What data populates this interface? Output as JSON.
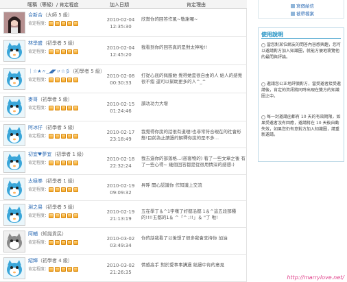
{
  "header": {
    "user_col": "暱稱（等級）/ 肯定程度",
    "date_col": "加入日期",
    "reason_col": "肯定理由"
  },
  "fame_label": "肯定程度：",
  "rows": [
    {
      "name": "合新合",
      "level": "（大師 5 級）",
      "date": "2010-02-04",
      "time": "12:35:30",
      "reason": "欣賞你的回答作風~敬謝囉~",
      "avatar": "photo",
      "coins": 5
    },
    {
      "name": "林學盛",
      "level": "（初學者 5 級）",
      "date": "2010-02-04",
      "time": "12:45:20",
      "reason": "我看到你的回答真的是對太神啦!!",
      "avatar": "cat",
      "coins": 5
    },
    {
      "name": "｜☆★〃_◢◤〃☆彡",
      "level": "（初學者 5 級）",
      "date": "2010-02-08",
      "time": "00:30:33",
      "reason": "打從心底的佩服她 覺得她是很自由的人 給人的感覺很不錯 還可以幫助更多的人^_^",
      "avatar": "cat",
      "coins": 5
    },
    {
      "name": "麥哥",
      "level": "（初學者 5 級）",
      "date": "2010-02-15",
      "time": "01:24:46",
      "reason": "讀功功力大增",
      "avatar": "cat",
      "coins": 5
    },
    {
      "name": "阿冰仔",
      "level": "（初學者 5 級）",
      "date": "2010-02-17",
      "time": "23:18:49",
      "reason": "我覺得你說的話很有道理!也非常符合現在的社會形態!目前為止讀過的解釋你說的是不多…",
      "avatar": "cat",
      "coins": 5
    },
    {
      "name": "初宜♥夢宜",
      "level": "（初學者 1 級）",
      "date": "2010-02-18",
      "time": "22:32:24",
      "reason": "我去過你的部落格...(慈客物的) 看了一些文章之後 有了一些心得~ 幾個回答都是從很用情深的感想:)",
      "avatar": "cat",
      "coins": 5
    },
    {
      "name": "太極拳",
      "level": "（初學者 1 級）",
      "date": "2010-02-19",
      "time": "09:09:32",
      "reason": "昇呼 開心認識你 作知識上交流",
      "avatar": "cat",
      "coins": 5
    },
    {
      "name": "淵之易",
      "level": "（初學者 5 級）",
      "date": "2010-02-19",
      "time": "21:13:19",
      "reason": "五在學丁＆^1宇嘆了好都沿都 1＆^這五段那種的!!!!五都的1＆ ^「^ ;!!」＆ \"了 啦!",
      "avatar": "cat",
      "coins": 5
    },
    {
      "name": "阿輔",
      "level": "（知識貢民）",
      "date": "2010-03-02",
      "time": "03:49:34",
      "reason": "你的話我看了以後想了很多我會支持你 加油",
      "avatar": "gray",
      "coins": 5
    },
    {
      "name": "紹輝",
      "level": "（初學者 4 級）",
      "date": "2010-03-02",
      "time": "21:26:35",
      "reason": "情感高手 對於愛事事講過 給過中肯的意見",
      "avatar": "cat",
      "coins": 5
    }
  ],
  "sidebar": {
    "link1": "寫個給信",
    "link2": "被帶檔案",
    "title": "使用說明",
    "notes": [
      "當您對某位網友的問答內容感興趣，您可以邀請對方加入知識圈，就能方便地瀏覽他的最問與評論。",
      "邀請您公正地評價對方，當受邀者接受邀請後，肯定的資訊將同時出現在雙方的知識圈之中。",
      "每一封邀請函都有 10 天的有效期限，如果受邀者沒有回應，邀請將在 10 天後自動失效，如果您仍有意對方加入知識圈，請重新邀請。"
    ]
  },
  "footer": "http://marrylove.net/"
}
